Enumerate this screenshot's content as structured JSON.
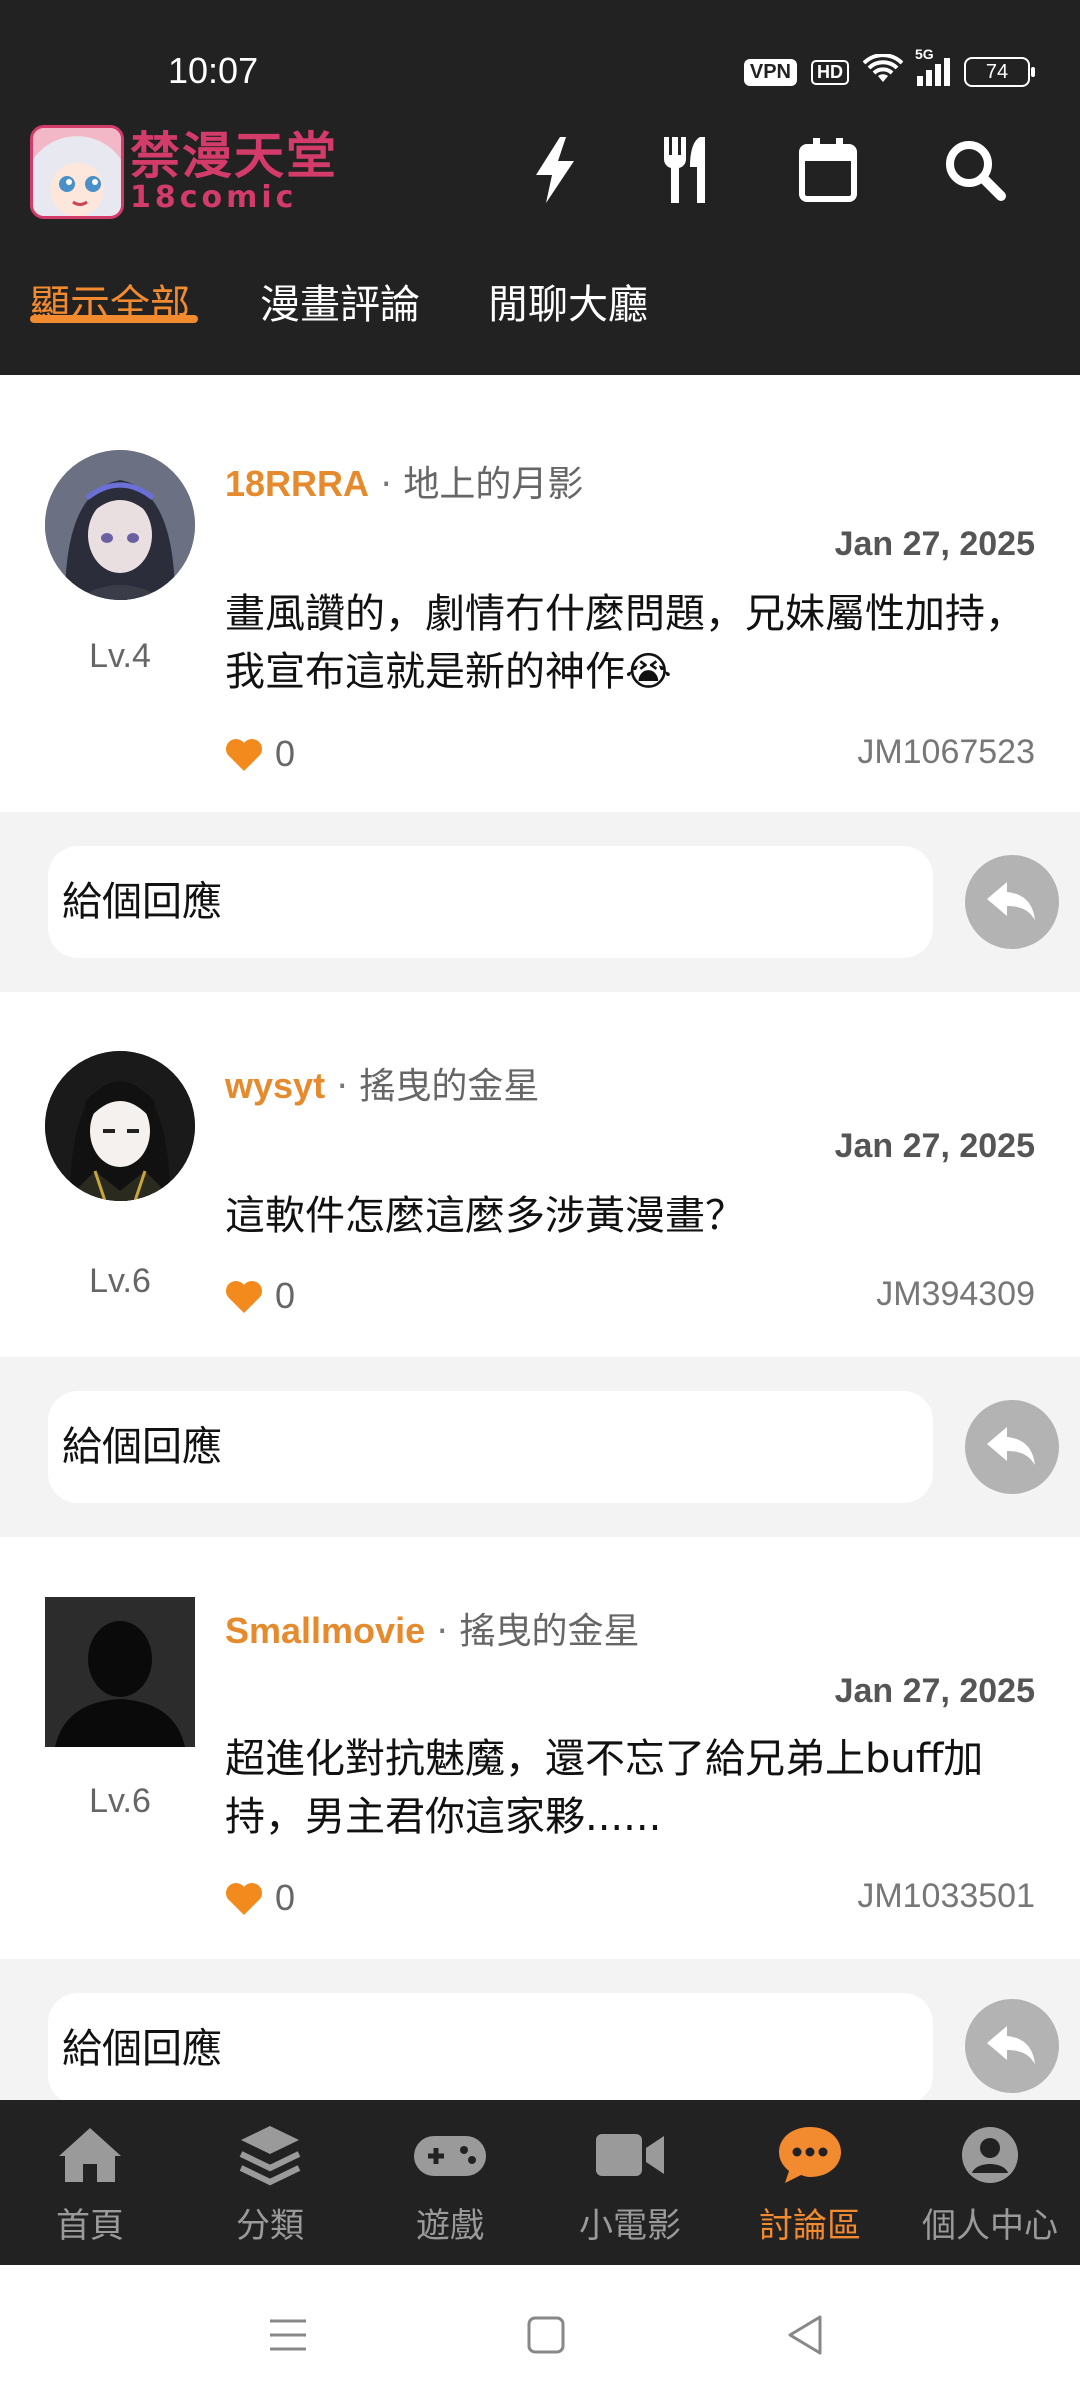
{
  "status_bar": {
    "time": "10:07",
    "vpn": "VPN",
    "hd": "HD",
    "network": "5G",
    "battery": "74"
  },
  "header": {
    "logo_cn": "禁漫天堂",
    "logo_en": "18comic",
    "icons": [
      "lightning-icon",
      "fork-knife-icon",
      "calendar-icon",
      "search-icon"
    ],
    "tabs": [
      {
        "label": "顯示全部",
        "active": true
      },
      {
        "label": "漫畫評論",
        "active": false
      },
      {
        "label": "閒聊大廳",
        "active": false
      }
    ],
    "accent_color": "#f28a30",
    "background_color": "#222222"
  },
  "comments": [
    {
      "username": "18RRRA",
      "separator": "·",
      "comic": "地上的月影",
      "date": "Jan 27, 2025",
      "level": "Lv.4",
      "text": "畫風讚的，劇情冇什麼問題，兄妹屬性加持，我宣布這就是新的神作😭",
      "likes": "0",
      "id": "JM1067523",
      "reply_placeholder": "給個回應"
    },
    {
      "username": "wysyt",
      "separator": "·",
      "comic": "搖曳的金星",
      "date": "Jan 27, 2025",
      "level": "Lv.6",
      "text": "這軟件怎麼這麼多涉黃漫畫？",
      "likes": "0",
      "id": "JM394309",
      "reply_placeholder": "給個回應"
    },
    {
      "username": "Smallmovie",
      "separator": "·",
      "comic": "搖曳的金星",
      "date": "Jan 27, 2025",
      "level": "Lv.6",
      "text": "超進化對抗魅魔，還不忘了給兄弟上buff加持，男主君你這家夥......",
      "likes": "0",
      "id": "JM1033501",
      "reply_placeholder": "給個回應"
    }
  ],
  "bottom_nav": [
    {
      "label": "首頁",
      "icon": "home-icon",
      "active": false
    },
    {
      "label": "分類",
      "icon": "layers-icon",
      "active": false
    },
    {
      "label": "遊戲",
      "icon": "gamepad-icon",
      "active": false
    },
    {
      "label": "小電影",
      "icon": "video-icon",
      "active": false
    },
    {
      "label": "討論區",
      "icon": "chat-icon",
      "active": true
    },
    {
      "label": "個人中心",
      "icon": "user-icon",
      "active": false
    }
  ],
  "system_nav": [
    "menu-icon",
    "home-square-icon",
    "back-triangle-icon"
  ]
}
